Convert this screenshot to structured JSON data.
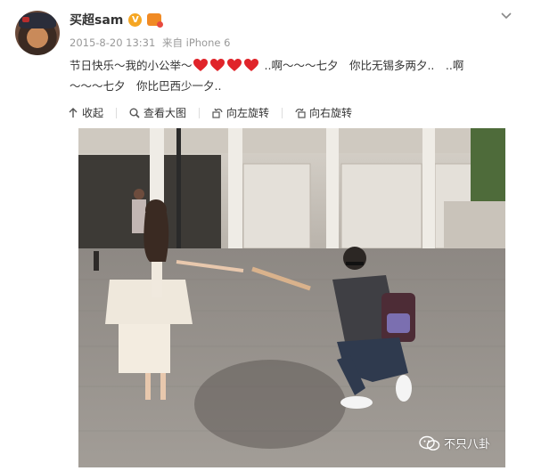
{
  "post": {
    "username": "买超sam",
    "verified_badge": "V",
    "timestamp": "2015-8-20 13:31",
    "source": "来自 iPhone 6",
    "text_line1_a": "节日快乐～我的小公举～",
    "text_line1_b": "..啊～～～七夕　你比无锡多两夕..　..啊",
    "text_line2": "～～～七夕　你比巴西少一夕..",
    "heart_count": 4,
    "heart_icon": "red-heart-emoji"
  },
  "actions": {
    "collapse": "收起",
    "view_large": "查看大图",
    "rotate_left": "向左旋转",
    "rotate_right": "向右旋转"
  },
  "watermark": {
    "text": "不只八卦",
    "icon": "wechat-icon"
  },
  "colors": {
    "heart": "#e0242a",
    "badge": "#f5a623",
    "meta_text": "#999999"
  }
}
